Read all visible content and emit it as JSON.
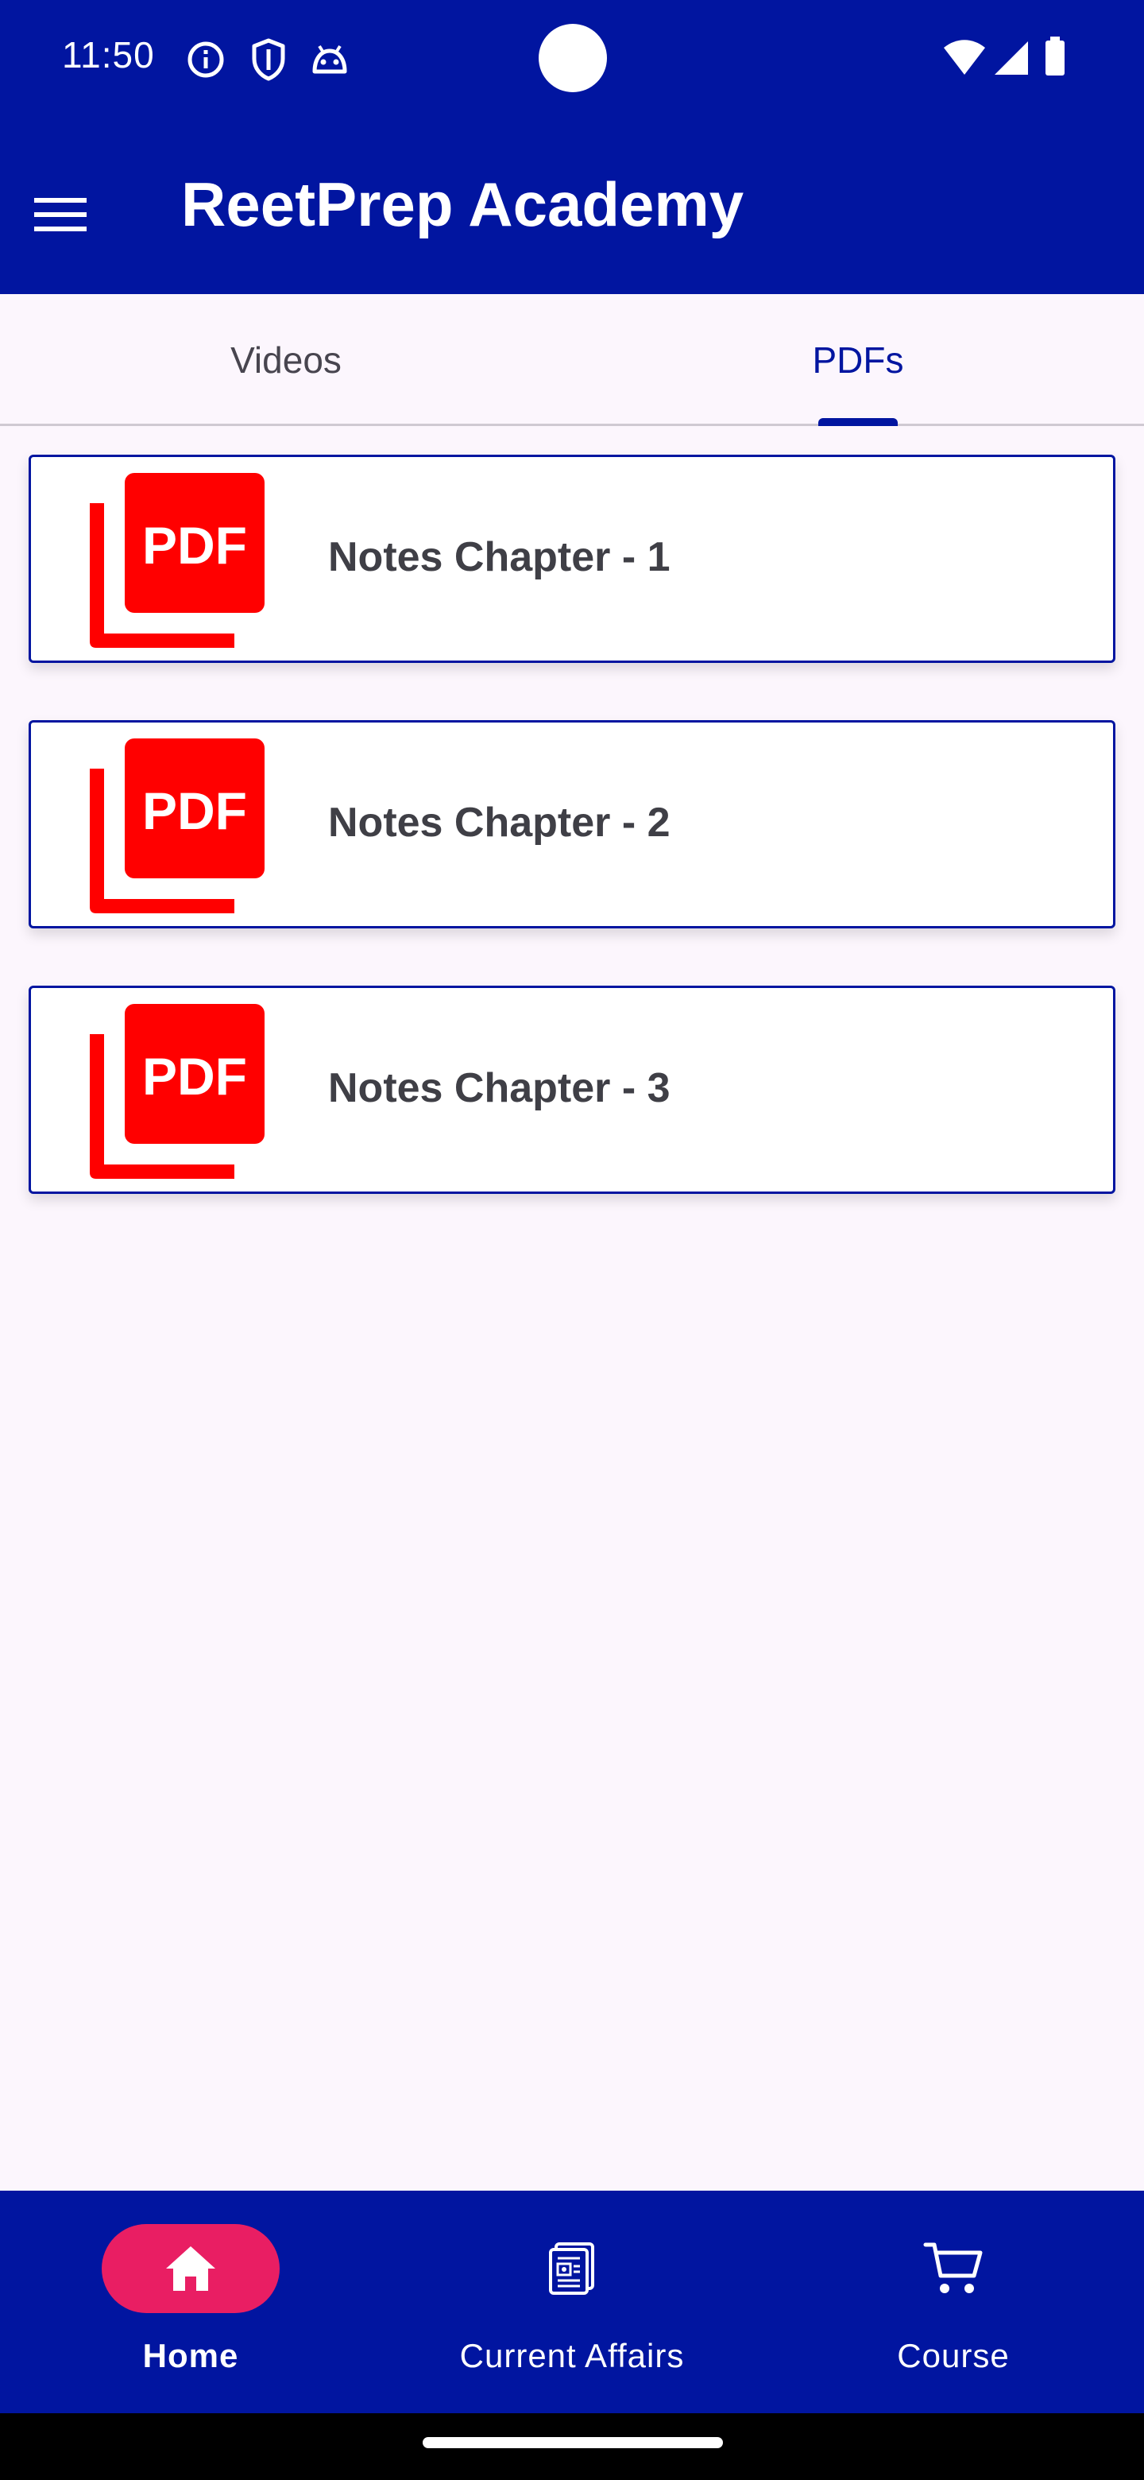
{
  "status_bar": {
    "time": "11:50",
    "icons": [
      "info-icon",
      "shield-icon",
      "android-icon",
      "wifi-icon",
      "signal-icon",
      "battery-icon"
    ]
  },
  "app_bar": {
    "title": "ReetPrep Academy",
    "menu_icon": "hamburger-menu-icon"
  },
  "tabs": {
    "items": [
      {
        "label": "Videos",
        "selected": false
      },
      {
        "label": "PDFs",
        "selected": true
      }
    ]
  },
  "pdfs": {
    "icon_label": "PDF",
    "items": [
      {
        "title": "Notes Chapter - 1"
      },
      {
        "title": "Notes Chapter - 2"
      },
      {
        "title": "Notes Chapter - 3"
      }
    ]
  },
  "bottom_nav": {
    "items": [
      {
        "label": "Home",
        "icon": "home-icon",
        "selected": true
      },
      {
        "label": "Current Affairs",
        "icon": "newspaper-icon",
        "selected": false
      },
      {
        "label": "Course",
        "icon": "cart-icon",
        "selected": false
      }
    ]
  },
  "colors": {
    "primary": "#0115a0",
    "accent": "#e91e63",
    "pdf_red": "#ff0000",
    "background": "#fcf6fd"
  }
}
